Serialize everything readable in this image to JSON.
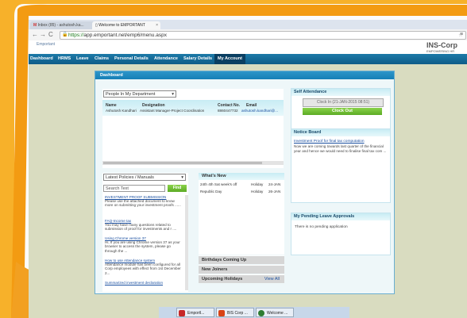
{
  "browser": {
    "tabs": [
      {
        "label": "Inbox (85) - ashutosh.ka..."
      },
      {
        "label": "Welcome to EMPORTANT"
      }
    ],
    "url_scheme": "https://",
    "url_host": "app.emportant.net",
    "url_path": "/emp6/menu.aspx"
  },
  "header": {
    "logo_left": "Emportant",
    "logo_right": "INS-Corp",
    "logo_right_sub": "EMPOWERING HR"
  },
  "menu": [
    "Dashboard",
    "HRMS",
    "Leave",
    "Claims",
    "Personal Details",
    "Attendance",
    "Salary Details",
    "My Account"
  ],
  "dashboard": {
    "title": "Dashboard",
    "dept_select": "People In My Department",
    "columns": [
      "Name",
      "Designation",
      "Contact No.",
      "Email"
    ],
    "row": {
      "name": "Ashutosh Kandhari",
      "designation": "Assistant Manager-Project Coordination",
      "contact": "8860447732",
      "email": "ashutosh.kandhari@..."
    }
  },
  "self_attendance": {
    "title": "Self Attendance",
    "clock_in": "Clock In (21-JAN-2015 08:51)",
    "clock_out": "Clock Out"
  },
  "notice_board": {
    "title": "Notice Board",
    "link": "Investment Proof for final tax computation",
    "text": "Now we are coming towards last quarter of the financial year and hence we would need to finalise final tax com ..."
  },
  "leave_approvals": {
    "title": "My Pending Leave Approvals",
    "text": "There is no pending application"
  },
  "policies": {
    "select": "Latest Policies / Manuals",
    "search_placeholder": "Search Text",
    "find": "Find",
    "items": [
      {
        "title": "INVESTMENT PROOF SUBMISSION",
        "text": "Please use the attached document to know more on submitting your investment proofs ......"
      },
      {
        "title": "FAQ-Income tax",
        "text": "You may have many questions related to submission of proof for investments and r ...."
      },
      {
        "title": "Using Chrome version 37",
        "text": "Hi, If you are using Chrome version 37 as your browser to access the system, please go through the ..."
      },
      {
        "title": "How to use Attendance system",
        "text": "Attendance module has been configured for all Corp employees with effect from 1st December 2..."
      },
      {
        "title": "Summarized investment declaration",
        "text": ""
      }
    ]
  },
  "whats_new": {
    "title": "What's New",
    "rows": [
      {
        "date": "24th 4th Sat week's off",
        "type": "Holiday",
        "day": "24-JAN"
      },
      {
        "date": "Republic Day",
        "type": "Holiday",
        "day": "26-JAN"
      }
    ],
    "birthdays": "Birthdays Coming Up",
    "new_joiners": "New Joiners",
    "upcoming": "Upcoming Holidays",
    "view_all": "View All"
  },
  "taskbar": [
    "Emportl...",
    "BIS Corp ...",
    "Welcome ..."
  ],
  "colors": {
    "menubar": "#1d7aa8",
    "accent_green": "#5cab25",
    "frame": "#f0a81e"
  }
}
